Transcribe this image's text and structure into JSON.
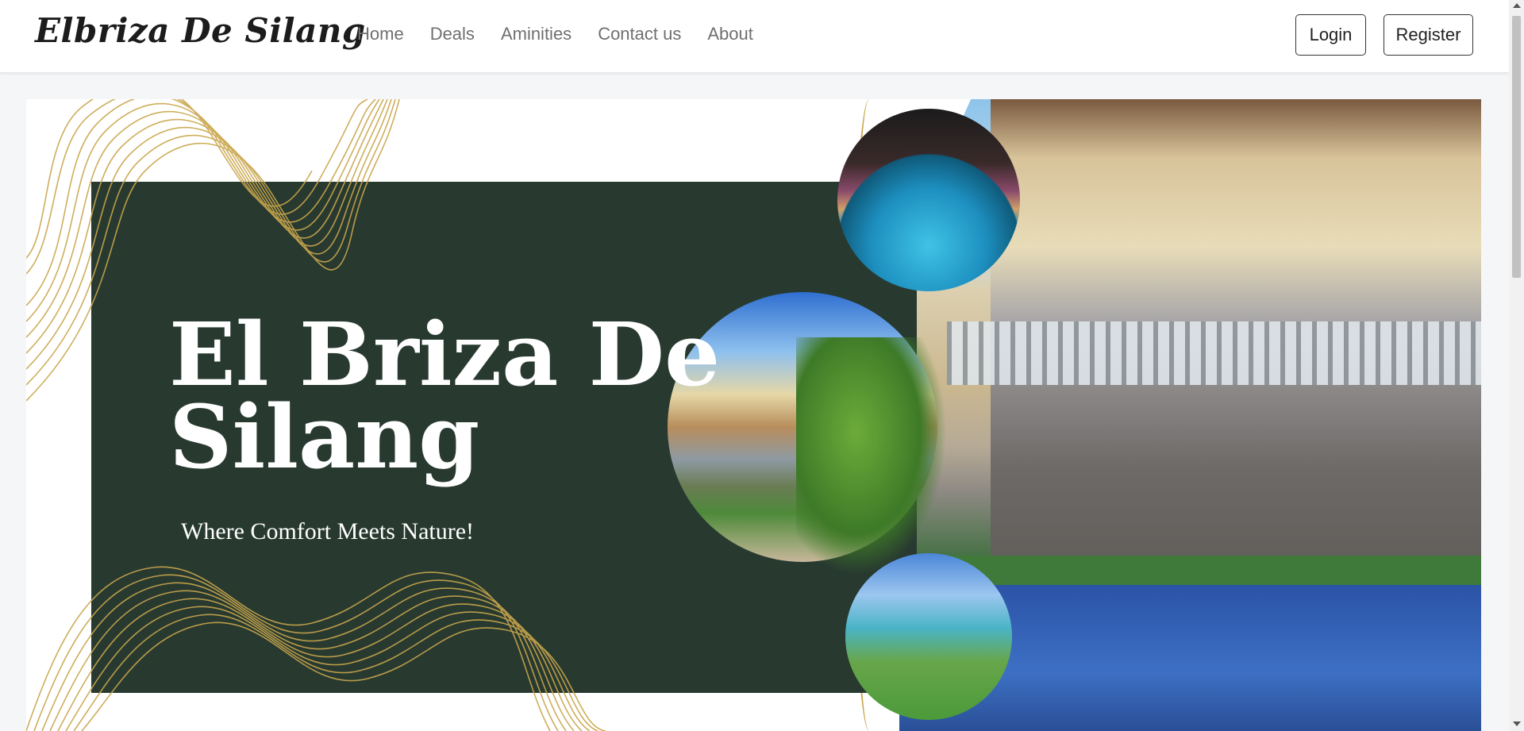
{
  "navbar": {
    "brand": "Elbriza De Silang",
    "links": [
      "Home",
      "Deals",
      "Aminities",
      "Contact us",
      "About"
    ],
    "login_label": "Login",
    "register_label": "Register"
  },
  "hero": {
    "title": "El Briza De Silang",
    "tagline": "Where Comfort Meets Nature!"
  },
  "colors": {
    "panel": "#283a30",
    "gold": "#c9a64c",
    "nav_text": "#6f6f6f"
  }
}
